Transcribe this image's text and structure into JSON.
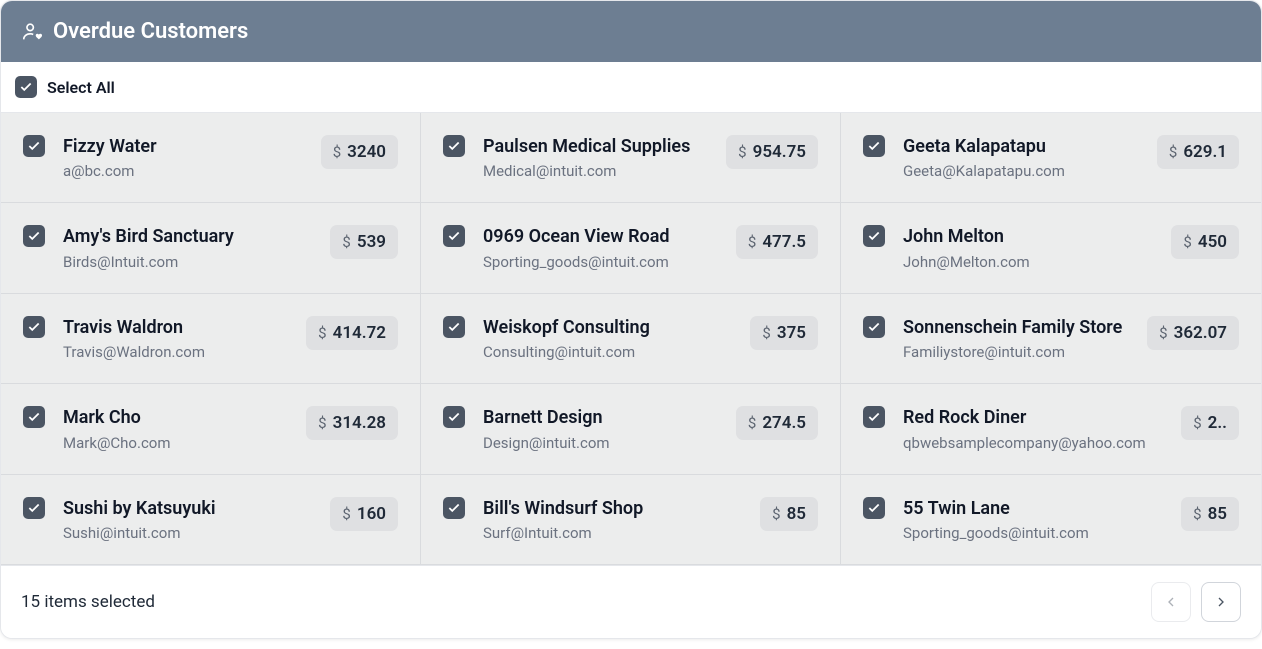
{
  "header": {
    "title": "Overdue Customers"
  },
  "selectAll": {
    "label": "Select All",
    "checked": true
  },
  "customers": [
    {
      "name": "Fizzy Water",
      "email": "a@bc.com",
      "amount": "3240"
    },
    {
      "name": "Paulsen Medical Supplies",
      "email": "Medical@intuit.com",
      "amount": "954.75"
    },
    {
      "name": "Geeta Kalapatapu",
      "email": "Geeta@Kalapatapu.com",
      "amount": "629.1"
    },
    {
      "name": "Amy's Bird Sanctuary",
      "email": "Birds@Intuit.com",
      "amount": "539"
    },
    {
      "name": "0969 Ocean View Road",
      "email": "Sporting_goods@intuit.com",
      "amount": "477.5"
    },
    {
      "name": "John Melton",
      "email": "John@Melton.com",
      "amount": "450"
    },
    {
      "name": "Travis Waldron",
      "email": "Travis@Waldron.com",
      "amount": "414.72"
    },
    {
      "name": "Weiskopf Consulting",
      "email": "Consulting@intuit.com",
      "amount": "375"
    },
    {
      "name": "Sonnenschein Family Store",
      "email": "Familiystore@intuit.com",
      "amount": "362.07"
    },
    {
      "name": "Mark Cho",
      "email": "Mark@Cho.com",
      "amount": "314.28"
    },
    {
      "name": "Barnett Design",
      "email": "Design@intuit.com",
      "amount": "274.5"
    },
    {
      "name": "Red Rock Diner",
      "email": "qbwebsamplecompany@yahoo.com",
      "amount": "2.."
    },
    {
      "name": "Sushi by Katsuyuki",
      "email": "Sushi@intuit.com",
      "amount": "160"
    },
    {
      "name": "Bill's Windsurf Shop",
      "email": "Surf@Intuit.com",
      "amount": "85"
    },
    {
      "name": "55 Twin Lane",
      "email": "Sporting_goods@intuit.com",
      "amount": "85"
    }
  ],
  "footer": {
    "status": "15 items selected"
  }
}
